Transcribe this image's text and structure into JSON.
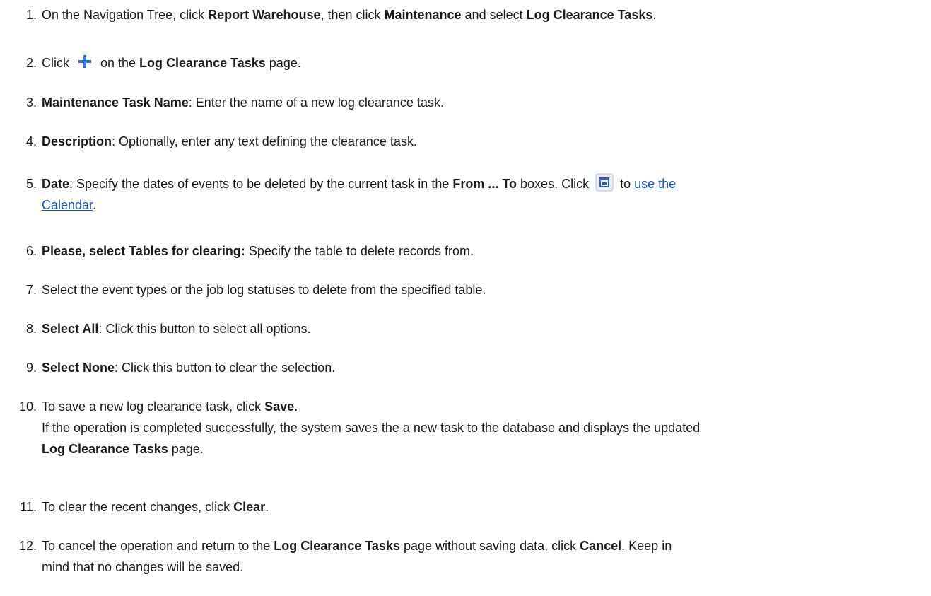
{
  "steps": [
    {
      "num": "1.",
      "p": [
        "On the Navigation Tree, click ",
        "Report Warehouse",
        ", then click ",
        "Maintenance",
        " and select ",
        "Log Clearance Tasks",
        "."
      ]
    },
    {
      "num": "2.",
      "p": [
        "Click ",
        " on the ",
        "Log Clearance Tasks",
        " page."
      ],
      "icon": "plus-icon"
    },
    {
      "num": "3.",
      "p": [
        "Maintenance Task Name",
        ": Enter the name of a new log clearance task."
      ]
    },
    {
      "num": "4.",
      "p": [
        "Description",
        ": Optionally, enter any text defining the clearance task."
      ]
    },
    {
      "num": "5.",
      "p": [
        "Date",
        ": Specify the dates of events to be deleted by the current task in the ",
        "From ... To",
        " boxes. Click ",
        " to ",
        "use the",
        "Calendar",
        "."
      ],
      "icon": "calendar-icon"
    },
    {
      "num": "6.",
      "p": [
        "Please, select Tables for clearing:",
        " Specify the table to delete records from."
      ]
    },
    {
      "num": "7.",
      "p": [
        "Select the event types or the job log statuses to delete from the specified table."
      ]
    },
    {
      "num": "8.",
      "p": [
        "Select All",
        ": Click this button to select all options."
      ]
    },
    {
      "num": "9.",
      "p": [
        "Select None",
        ": Click this button to clear the selection."
      ]
    },
    {
      "num": "10.",
      "p": [
        "To save a new log clearance task, click ",
        "Save",
        ".",
        "If the operation is completed successfully, the system saves the a new  task to the database and displays the updated",
        "Log Clearance Tasks",
        " page."
      ]
    },
    {
      "num": "11.",
      "p": [
        "To clear the recent changes, click ",
        "Clear",
        "."
      ]
    },
    {
      "num": "12.",
      "p": [
        "To cancel the operation and return  to the ",
        "Log Clearance Tasks",
        " page without saving data, click ",
        "Cancel",
        ". Keep in",
        "mind that no changes will be saved."
      ]
    }
  ]
}
